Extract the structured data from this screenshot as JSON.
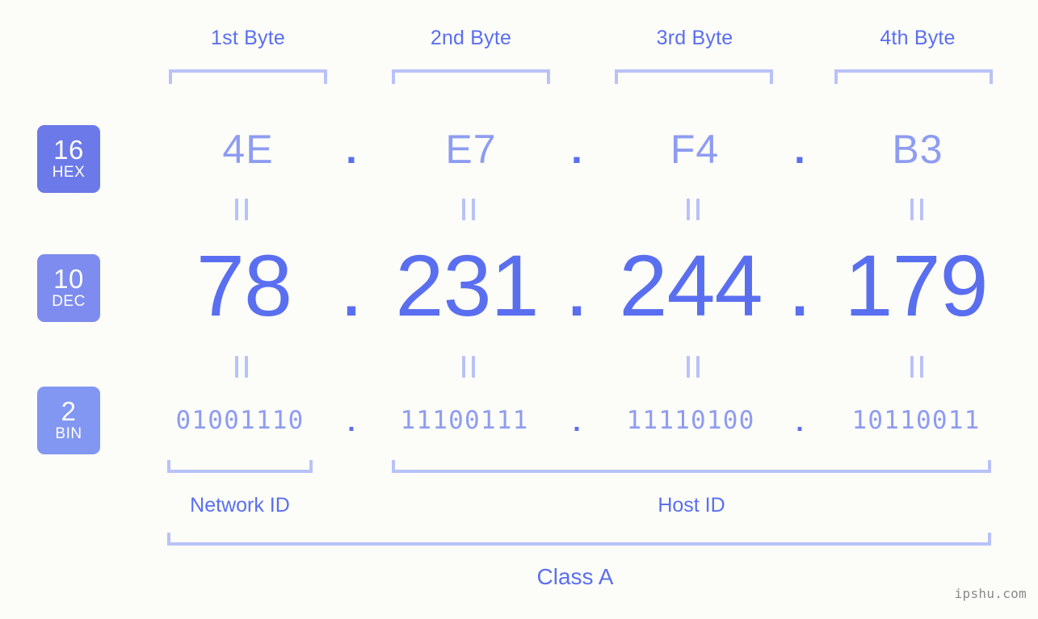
{
  "watermark": "ipshu.com",
  "background_color": "#fcfdf8",
  "accent_color": "#5a6ff0",
  "light_accent_color": "#b9c2f8",
  "byte_headers": [
    {
      "label": "1st Byte"
    },
    {
      "label": "2nd Byte"
    },
    {
      "label": "3rd Byte"
    },
    {
      "label": "4th Byte"
    }
  ],
  "rows": {
    "hex": {
      "radix": "16",
      "radix_name": "HEX",
      "badge_color": "#6b7ae8",
      "values": [
        "4E",
        "E7",
        "F4",
        "B3"
      ],
      "separator": "."
    },
    "dec": {
      "radix": "10",
      "radix_name": "DEC",
      "badge_color": "#7d8cee",
      "values": [
        "78",
        "231",
        "244",
        "179"
      ],
      "separator": "."
    },
    "bin": {
      "radix": "2",
      "radix_name": "BIN",
      "badge_color": "#8197f2",
      "values": [
        "01001110",
        "11100111",
        "11110100",
        "10110011"
      ],
      "separator": "."
    }
  },
  "segments": {
    "network_id": "Network ID",
    "host_id": "Host ID"
  },
  "class_label": "Class A",
  "ip_address": {
    "hex": "4E.E7.F4.B3",
    "dec": "78.231.244.179",
    "bin": "01001110.11100111.11110100.10110011"
  }
}
